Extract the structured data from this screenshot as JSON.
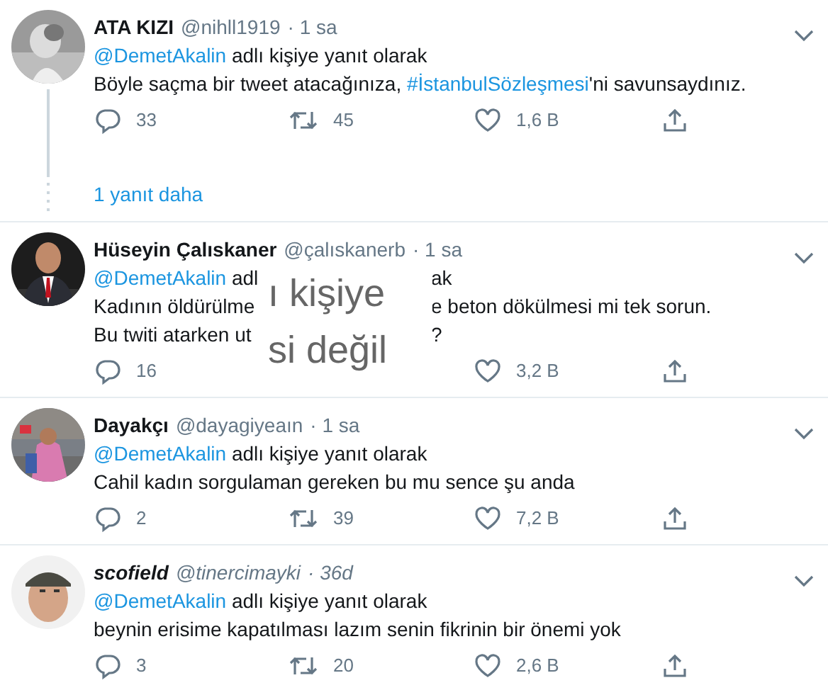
{
  "tweets": [
    {
      "name": "ATA KIZI",
      "handle": "@nihll1919",
      "time": "· 1 sa",
      "italic": false,
      "lines": [
        [
          {
            "kind": "mention",
            "text": "@DemetAkalin"
          },
          {
            "kind": "text",
            "text": " adlı kişiye yanıt olarak"
          }
        ],
        [
          {
            "kind": "text",
            "text": "Böyle saçma bir tweet atacağınıza,     "
          },
          {
            "kind": "hashtag",
            "text": "#İstanbulSözleşmesi"
          },
          {
            "kind": "text",
            "text": "'ni savunsaydınız."
          }
        ]
      ],
      "actions": [
        {
          "kind": "reply",
          "count": "33"
        },
        {
          "kind": "retweet",
          "count": "45"
        },
        {
          "kind": "like",
          "count": "1,6 B"
        },
        {
          "kind": "share"
        }
      ],
      "more_replies": "1 yanıt daha"
    },
    {
      "name": "Hüseyin Çalıskaner",
      "handle": "@çalıskanerb",
      "time": "· 1 sa",
      "italic": false,
      "lines": [
        [
          {
            "kind": "mention",
            "text": "@DemetAkalin"
          },
          {
            "kind": "text",
            "text": " adl"
          },
          {
            "kind": "hidden"
          },
          {
            "kind": "text",
            "text": "ak"
          }
        ],
        [
          {
            "kind": "text",
            "text": "Kadının öldürülme"
          },
          {
            "kind": "hidden"
          },
          {
            "kind": "text",
            "text": "e beton dökülmesi mi tek sorun."
          }
        ],
        [
          {
            "kind": "text",
            "text": "Bu twiti atarken ut"
          },
          {
            "kind": "hidden"
          },
          {
            "kind": "text",
            "text": "?"
          }
        ]
      ],
      "actions": [
        {
          "kind": "reply",
          "count": "16"
        },
        {
          "kind": "like",
          "count": "3,2 B"
        },
        {
          "kind": "share"
        }
      ],
      "overlay": [
        "ı kişiye",
        "si değil"
      ]
    },
    {
      "name": "Dayakçı",
      "handle": "@dayagiyeaın",
      "time": "· 1 sa",
      "italic": false,
      "lines": [
        [
          {
            "kind": "mention",
            "text": "@DemetAkalin"
          },
          {
            "kind": "text",
            "text": " adlı kişiye yanıt olarak"
          }
        ],
        [
          {
            "kind": "text",
            "text": "Cahil kadın sorgulaman gereken bu mu sence şu anda"
          }
        ]
      ],
      "actions": [
        {
          "kind": "reply",
          "count": "2"
        },
        {
          "kind": "retweet",
          "count": "39"
        },
        {
          "kind": "like",
          "count": "7,2 B"
        },
        {
          "kind": "share"
        }
      ]
    },
    {
      "name": "scofield",
      "handle": "@tinercimayki",
      "time": "· 36d",
      "italic": true,
      "lines": [
        [
          {
            "kind": "mention",
            "text": "@DemetAkalin"
          },
          {
            "kind": "text",
            "text": " adlı kişiye yanıt olarak"
          }
        ],
        [
          {
            "kind": "text",
            "text": "beynin erisime kapatılması lazım senin fikrinin bir önemi yok"
          }
        ]
      ],
      "actions": [
        {
          "kind": "reply",
          "count": "3"
        },
        {
          "kind": "retweet",
          "count": "20"
        },
        {
          "kind": "like",
          "count": "2,6 B"
        },
        {
          "kind": "share"
        }
      ]
    }
  ]
}
